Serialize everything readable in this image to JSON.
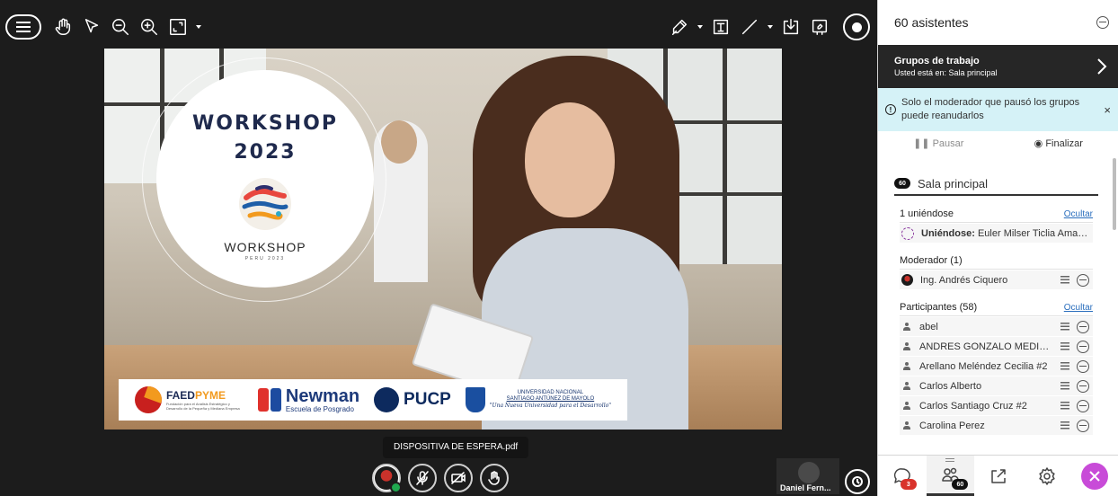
{
  "slide": {
    "logo_title": "WORKSHOP\n2023",
    "logo_word": "WORKSHOP",
    "logo_sub": "PERU 2023",
    "sponsors": {
      "faed_a": "FAED",
      "faed_b": "PYME",
      "faed_desc": "Fundación para el Análisis Estratégico y Desarrollo de la Pequeña y Mediana Empresa",
      "newman": "Newman",
      "newman_sub": "Escuela de Posgrado",
      "pucp": "PUCP",
      "unasam_1": "UNIVERSIDAD NACIONAL",
      "unasam_2": "SANTIAGO ANTÚNEZ DE MAYOLO",
      "unasam_3": "\"Una Nueva Universidad para el Desarrollo\""
    }
  },
  "stage": {
    "file_name": "DISPOSITIVA DE ESPERA.pdf",
    "speaker_name": "Daniel Fern..."
  },
  "panel": {
    "attendees_title": "60 asistentes",
    "groups_title": "Grupos de trabajo",
    "groups_location": "Usted está en: Sala principal",
    "notice": "Solo el moderador que pausó los grupos puede reanudarlos",
    "notice_close": "×",
    "pause_label": "Pausar",
    "finish_label": "Finalizar",
    "room_count": "60",
    "room_name": "Sala principal",
    "joining": {
      "header": "1 uniéndose",
      "hide": "Ocultar",
      "prefix": "Uniéndose:",
      "name": "Euler Milser Ticlia Amado..."
    },
    "moderator": {
      "header": "Moderador (1)",
      "name": "Ing. Andrés Ciquero"
    },
    "participants": {
      "header": "Participantes (58)",
      "hide": "Ocultar",
      "items": [
        "abel",
        "ANDRES GONZALO MEDINA ...",
        "Arellano Meléndez Cecilia #2",
        "Carlos Alberto",
        "Carlos Santiago Cruz #2",
        "Carolina Perez"
      ]
    },
    "footer": {
      "chat_count": "3",
      "attendees_count": "60"
    }
  },
  "colors": {
    "panel_notice_bg": "#d5f2f7",
    "groups_bg": "#262626",
    "link": "#2a6ebd",
    "close_accent": "#c84bd8",
    "ok_green": "#1fa84f",
    "chat_badge": "#d9322b"
  }
}
